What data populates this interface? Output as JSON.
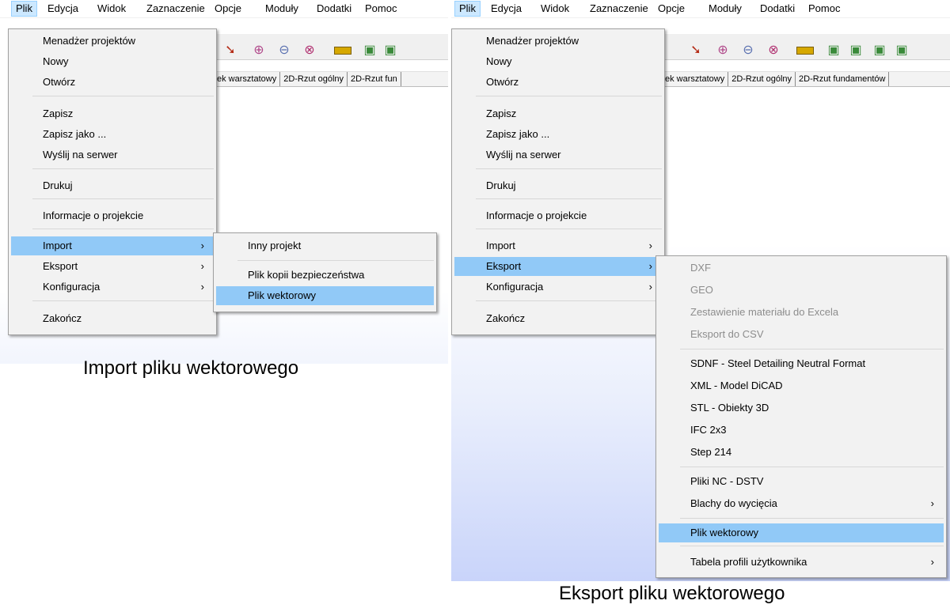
{
  "menubar": {
    "items": [
      "Plik",
      "Edycja",
      "Widok",
      "Zaznaczenie",
      "Opcje",
      "Moduły",
      "Dodatki",
      "Pomoc"
    ]
  },
  "left_tabs": [
    "ek warsztatowy",
    "2D-Rzut ogólny",
    "2D-Rzut fun"
  ],
  "right_tabs": [
    "ek warsztatowy",
    "2D-Rzut ogólny",
    "2D-Rzut fundamentów"
  ],
  "file_menu": {
    "items": [
      "Menadżer projektów",
      "Nowy",
      "Otwórz",
      "Zapisz",
      "Zapisz jako ...",
      "Wyślij na serwer",
      "Drukuj",
      "Informacje o projekcie",
      "Import",
      "Eksport",
      "Konfiguracja",
      "Zakończ"
    ],
    "submenu_arrow": "›"
  },
  "import_submenu": {
    "items": [
      "Inny projekt",
      "Plik kopii bezpieczeństwa",
      "Plik wektorowy"
    ],
    "highlighted": "Plik wektorowy"
  },
  "export_submenu": {
    "items": [
      "DXF",
      "GEO",
      "Zestawienie materiału do Excela",
      "Eksport do CSV",
      "SDNF - Steel Detailing Neutral Format",
      "XML - Model DiCAD",
      "STL - Obiekty 3D",
      "IFC  2x3",
      "Step 214",
      "Pliki NC - DSTV",
      "Blachy do wycięcia",
      "Plik wektorowy",
      "Tabela profili użytkownika"
    ],
    "disabled": [
      "DXF",
      "GEO",
      "Zestawienie materiału do Excela",
      "Eksport do CSV"
    ],
    "highlighted": "Plik wektorowy"
  },
  "captions": {
    "left": "Import pliku wektorowego",
    "right": "Eksport pliku wektorowego"
  },
  "colors": {
    "highlight": "#91c9f7",
    "menu_bg": "#f2f2f2",
    "disabled_text": "#8d8d8d",
    "menubar_active": "#cce8ff"
  },
  "icons": [
    "redo-arrow-icon",
    "zoom-in-icon",
    "zoom-out-icon",
    "zoom-window-icon",
    "measure-ruler-icon",
    "3d-view-icon"
  ]
}
